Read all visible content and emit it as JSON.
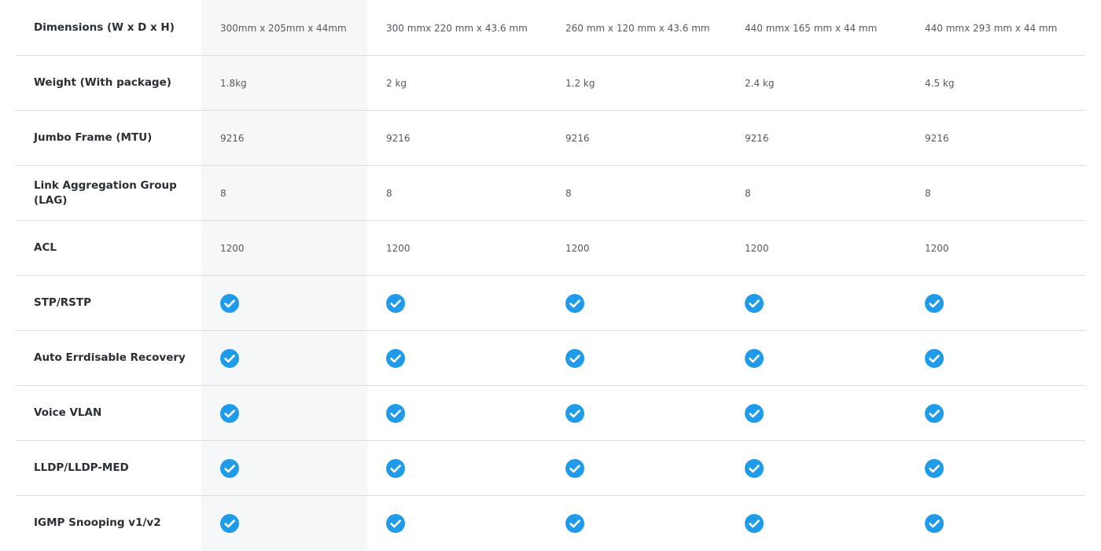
{
  "spec_table": {
    "accent_color": "#1f9bea",
    "check_icon": "check-circle-icon",
    "rows": [
      {
        "label": "Dimensions (W x D x H)",
        "type": "text",
        "values": [
          "300mm x 205mm x 44mm",
          "300 mmx 220 mm x 43.6 mm",
          "260 mm x 120 mm x 43.6 mm",
          "440 mmx 165 mm x 44 mm",
          "440 mmx 293 mm x 44 mm"
        ]
      },
      {
        "label": "Weight (With package)",
        "type": "text",
        "values": [
          "1.8kg",
          "2 kg",
          "1.2 kg",
          "2.4 kg",
          "4.5 kg"
        ]
      },
      {
        "label": "Jumbo Frame (MTU)",
        "type": "text",
        "values": [
          "9216",
          "9216",
          "9216",
          "9216",
          "9216"
        ]
      },
      {
        "label": "Link Aggregation Group (LAG)",
        "type": "text",
        "values": [
          "8",
          "8",
          "8",
          "8",
          "8"
        ]
      },
      {
        "label": "ACL",
        "type": "text",
        "values": [
          "1200",
          "1200",
          "1200",
          "1200",
          "1200"
        ]
      },
      {
        "label": "STP/RSTP",
        "type": "check",
        "values": [
          true,
          true,
          true,
          true,
          true
        ]
      },
      {
        "label": "Auto Errdisable Recovery",
        "type": "check",
        "values": [
          true,
          true,
          true,
          true,
          true
        ]
      },
      {
        "label": "Voice VLAN",
        "type": "check",
        "values": [
          true,
          true,
          true,
          true,
          true
        ]
      },
      {
        "label": "LLDP/LLDP-MED",
        "type": "check",
        "values": [
          true,
          true,
          true,
          true,
          true
        ]
      },
      {
        "label": "IGMP Snooping v1/v2",
        "type": "check",
        "values": [
          true,
          true,
          true,
          true,
          true
        ]
      }
    ]
  }
}
